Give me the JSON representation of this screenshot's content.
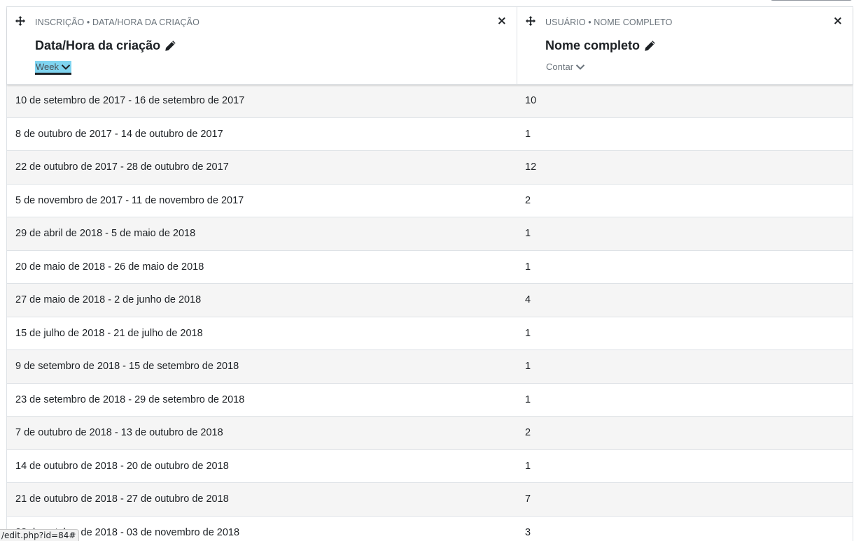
{
  "columns": [
    {
      "subtitle": "Inscrição • Data/Hora da criação",
      "title": "Data/Hora da criação",
      "aggregation": "Week",
      "move_icon": "move-icon",
      "edit_icon": "pencil-icon",
      "remove_label": "×"
    },
    {
      "subtitle": "Usuário • Nome completo",
      "title": "Nome completo",
      "aggregation": "Contar",
      "move_icon": "move-icon",
      "edit_icon": "pencil-icon",
      "remove_label": "×"
    }
  ],
  "rows": [
    {
      "period": "10 de setembro de 2017 - 16 de setembro de 2017",
      "count": "10"
    },
    {
      "period": "8 de outubro de 2017 - 14 de outubro de 2017",
      "count": "1"
    },
    {
      "period": "22 de outubro de 2017 - 28 de outubro de 2017",
      "count": "12"
    },
    {
      "period": "5 de novembro de 2017 - 11 de novembro de 2017",
      "count": "2"
    },
    {
      "period": "29 de abril de 2018 - 5 de maio de 2018",
      "count": "1"
    },
    {
      "period": "20 de maio de 2018 - 26 de maio de 2018",
      "count": "1"
    },
    {
      "period": "27 de maio de 2018 - 2 de junho de 2018",
      "count": "4"
    },
    {
      "period": "15 de julho de 2018 - 21 de julho de 2018",
      "count": "1"
    },
    {
      "period": "9 de setembro de 2018 - 15 de setembro de 2018",
      "count": "1"
    },
    {
      "period": "23 de setembro de 2018 - 29 de setembro de 2018",
      "count": "1"
    },
    {
      "period": "7 de outubro de 2018 - 13 de outubro de 2018",
      "count": "2"
    },
    {
      "period": "14 de outubro de 2018 - 20 de outubro de 2018",
      "count": "1"
    },
    {
      "period": "21 de outubro de 2018 - 27 de outubro de 2018",
      "count": "7"
    },
    {
      "period": "28 de outubro de 2018 - 03 de novembro de 2018",
      "count": "3"
    }
  ],
  "status_bar": {
    "url": "/edit.php?id=84#"
  },
  "colors": {
    "active_aggregation_bg": "#7fd4f0",
    "row_alt_bg": "#f5f5f5",
    "border": "#dee2e6",
    "muted_text": "#6a737b"
  }
}
